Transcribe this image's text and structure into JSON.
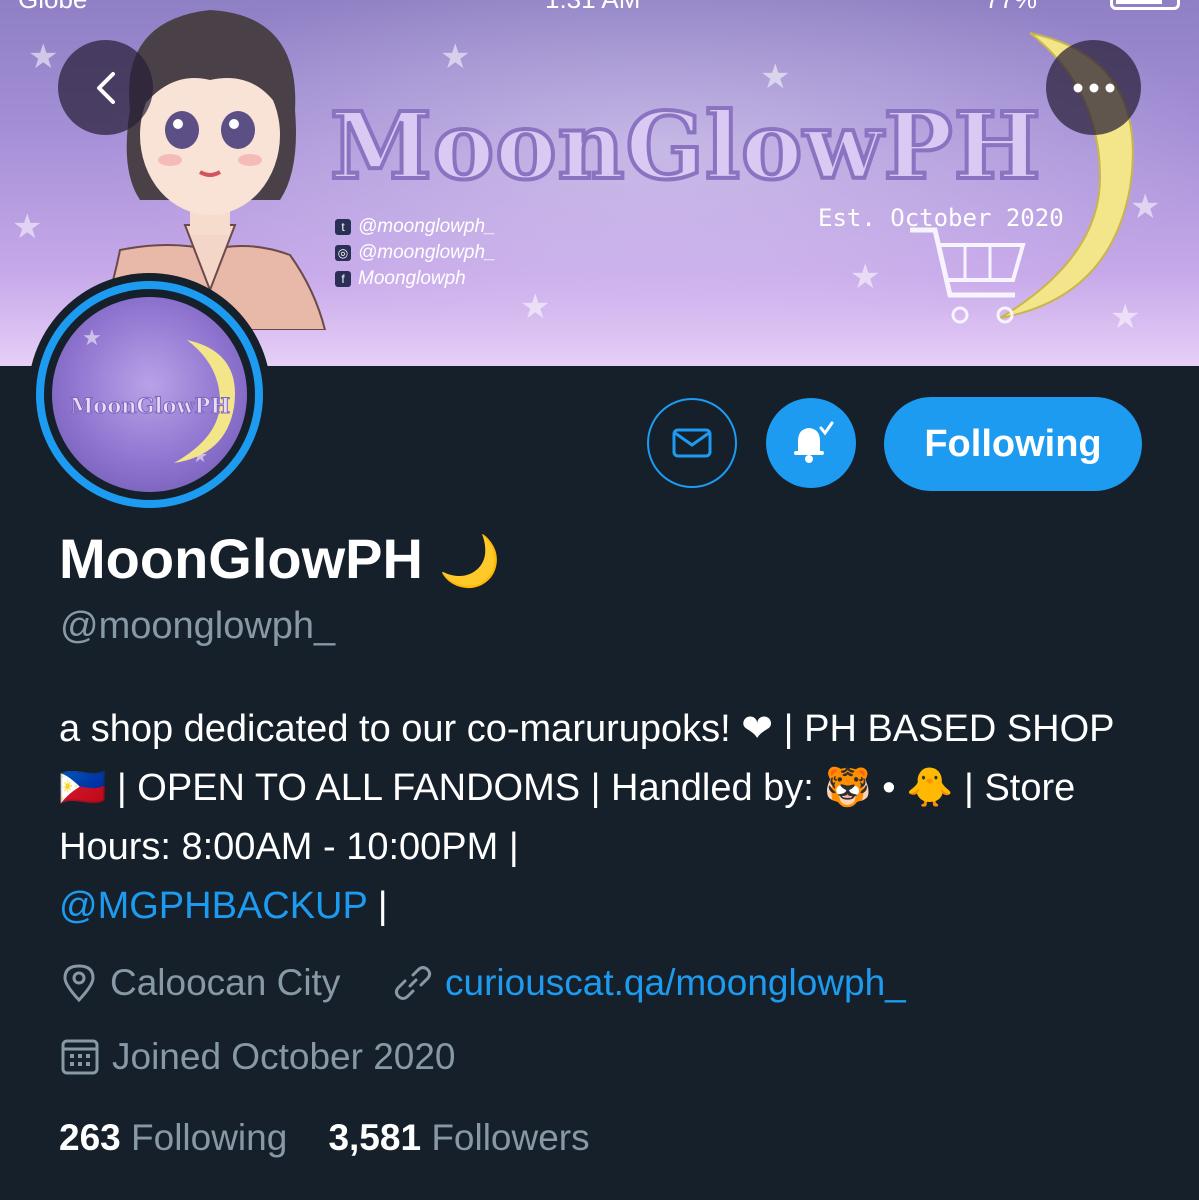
{
  "status_bar": {
    "carrier": "Globe",
    "time": "1:31 AM",
    "battery": "77%"
  },
  "banner": {
    "title": "MoonGlowPH",
    "est": "Est. October 2020",
    "socials": [
      {
        "icon": "twitter-icon",
        "text": "@moonglowph_"
      },
      {
        "icon": "instagram-icon",
        "text": "@moonglowph_"
      },
      {
        "icon": "facebook-icon",
        "text": "Moonglowph"
      }
    ]
  },
  "avatar": {
    "text": "MoonGlowPH"
  },
  "actions": {
    "message_icon": "mail-icon",
    "notify_icon": "bell-check-icon",
    "following_label": "Following"
  },
  "profile": {
    "name": "MoonGlowPH",
    "name_emoji": "🌙",
    "handle": "@moonglowph_",
    "bio_part1": "a shop dedicated to our co-marurupoks! ❤︎ | PH BASED SHOP 🇵🇭  | OPEN TO ALL FANDOMS | Handled by: 🐯 • 🐥 | Store Hours: 8:00AM - 10:00PM |",
    "bio_mention": "@MGPHBACKUP",
    "bio_end": " |",
    "location": "Caloocan City",
    "website": "curiouscat.qa/moonglowph_",
    "joined": "Joined October 2020"
  },
  "stats": {
    "following_count": "263",
    "following_label": "Following",
    "followers_count": "3,581",
    "followers_label": "Followers"
  },
  "colors": {
    "background": "#15202b",
    "accent": "#1d9bf0",
    "secondary_text": "#8899a6"
  }
}
